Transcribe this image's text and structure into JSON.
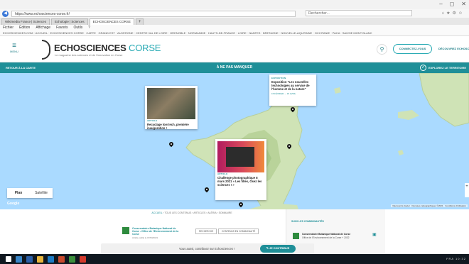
{
  "browser": {
    "win_controls": [
      "–",
      "◻",
      "✕"
    ],
    "url": "https://www.echosciences-corse.fr/",
    "search_placeholder": "Rechercher...",
    "tabs": [
      {
        "label": "Wikimedia France | Sciences"
      },
      {
        "label": "Echologie | Sciences"
      },
      {
        "label": "ECHOSCIENCES CORSE"
      }
    ],
    "menu": [
      "Fichier",
      "Édition",
      "Affichage",
      "Favoris",
      "Outils",
      "?"
    ],
    "favorites": "ECHOSCIENCES.COM · ACCUEIL · ECHOSCIENCES CORSE · CARTE · GRAND EST · AUVERGNE · CENTRE VAL DE LOIRE · GRENOBLE · NORMANDIE · HAUTS-DE-FRANCE · LOIRE · NANTES · BRETAGNE · NOUVELLE-AQUITAINE · OCCITANIE · PACA · SAVOIE MONT BLANC"
  },
  "header": {
    "menu_label": "MENU",
    "logo_main": "ECHOSCIENCES",
    "logo_accent": "CORSE",
    "logo_sub": "Le magazine des sciences et de l'innovation en Corse",
    "connect_label": "CONNECTEZ-VOUS",
    "discover_label": "DÉCOUVREZ ECHOSCIENCES"
  },
  "teal_bar": {
    "left": "RETOUR À LA CARTE",
    "center": "À NE PAS MANQUER",
    "right": "EXPLOREZ LE TERRITOIRE"
  },
  "map": {
    "type_plan": "Plan",
    "type_satellite": "Satellite",
    "google": "Google",
    "terms": "Raccourcis clavier · Données cartographiques ©2021 · Conditions d'utilisation",
    "zoom_plus": "+"
  },
  "cards": [
    {
      "category": "ARTICLE",
      "title": "Recyclage low tech, première inauguration !",
      "date": ""
    },
    {
      "category": "EXPOSITION",
      "title": "Exposition \"Les nouvelles technologies au service de l'homme et de la nature\"",
      "date": "15 FÉVRIER → 15 AVRIL"
    },
    {
      "category": "ARTICLE",
      "title": "Challenge photographique 8 mars 2021 « Les filles, Osez les sciences ! »",
      "date": ""
    }
  ],
  "content": {
    "breadcrumb_home": "ACCUEIL",
    "breadcrumb_rest": "› TOUS LES CONTENUS › ARTICLES › ALÉRIA › SOMMAIRE",
    "author_name": "Conservatoire Botanique National de Corse - Office de l'Environnement de la Corse",
    "author_published": "Article publié le 07/03/2021",
    "chip_1": "RECHERCHE",
    "chip_2": "CONTENUS EN COMMUNAUTÉ",
    "side_title": "SUIVI LES COMMUNAUTÉS",
    "side_item_1": "Conservatoire Botanique National de Corse",
    "side_item_2": "Office de l'Environnement de la Corse + 2032"
  },
  "prompt": {
    "text": "Vous aussi, contribuez sur Echosciences !",
    "button": "✎ JE CONTRIBUE"
  },
  "taskbar": {
    "right": "FRA  10:32"
  },
  "colors": {
    "teal": "#1f8f98",
    "accent": "#25a9b3",
    "sea": "#aadaff",
    "land": "#d7e8c0"
  }
}
